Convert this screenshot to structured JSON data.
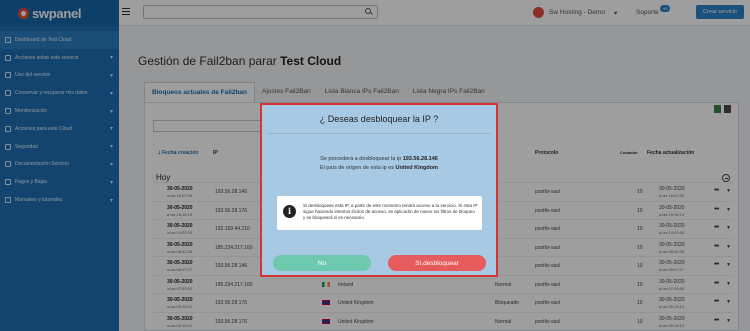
{
  "sidebar": {
    "logo_text": "swpanel",
    "items": [
      {
        "label": "Dashboard de Test Cloud",
        "icon": "dashboard-icon",
        "active": true,
        "caret": ""
      },
      {
        "label": "Acciones sobre este servicio",
        "icon": "gear-icon",
        "caret": "▾"
      },
      {
        "label": "Uso del servicio",
        "icon": "chart-icon",
        "caret": "▾"
      },
      {
        "label": "Conservar y recuperar mis datos",
        "icon": "database-icon",
        "caret": "▾"
      },
      {
        "label": "Monitorización",
        "icon": "monitor-icon",
        "caret": "▾"
      },
      {
        "label": "Acciones para este Cloud",
        "icon": "cloud-icon",
        "caret": "▾"
      },
      {
        "label": "Seguridad",
        "icon": "shield-icon",
        "caret": "▾"
      },
      {
        "label": "Documentación Servicio",
        "icon": "document-icon",
        "caret": "▾"
      },
      {
        "label": "Pagos y Bajas",
        "icon": "payment-icon",
        "caret": "▾"
      },
      {
        "label": "Manuales y tutoriales",
        "icon": "help-icon",
        "caret": "▾"
      }
    ]
  },
  "topbar": {
    "account": "Sw Hosting - Demo",
    "account_caret": "▾",
    "support": "Soporte",
    "support_badge": "99",
    "new_service_button": "Crear servicio"
  },
  "main": {
    "title_prefix": "Gestión de Fail2ban parar",
    "title_bold": "Test Cloud",
    "tabs": [
      {
        "label": "Bloqueos actuales de Fail2ban",
        "active": true
      },
      {
        "label": "Ajustes Fail2Ban"
      },
      {
        "label": "Lista Blanca IPs Fail2Ban"
      },
      {
        "label": "Lista Negra IPs Fail2Ban"
      }
    ],
    "table": {
      "headers": {
        "fecha": "Fecha creación",
        "ip": "IP",
        "protocolo": "Protocolo",
        "contador": "Contador",
        "actualizacion": "Fecha actualización"
      },
      "sort_arrow": "🡓",
      "group_label": "Hoy",
      "rows": [
        {
          "d1": "30-05-2020",
          "d2": "a las 16:07:29",
          "ip": "193.56.28.146",
          "country": "",
          "status": "",
          "protocol": "postfix-sasl",
          "count": "10",
          "u1": "30-05-2020",
          "u2": "a las 16:07:29"
        },
        {
          "d1": "30-05-2020",
          "d2": "a las 15:16:13",
          "ip": "193.56.28.176",
          "country": "",
          "status": "",
          "protocol": "postfix-sasl",
          "count": "10",
          "u1": "30-05-2020",
          "u2": "a las 15:16:13"
        },
        {
          "d1": "30-05-2020",
          "d2": "a las 14:02:03",
          "ip": "192.169.44.210",
          "country": "",
          "status": "",
          "protocol": "postfix-sasl",
          "count": "10",
          "u1": "30-05-2020",
          "u2": "a las 14:02:03"
        },
        {
          "d1": "30-05-2020",
          "d2": "a las 08:42:28",
          "ip": "185.234.217.160",
          "country": "",
          "status": "",
          "protocol": "postfix-sasl",
          "count": "10",
          "u1": "30-05-2020",
          "u2": "a las 08:42:28"
        },
        {
          "d1": "30-05-2020",
          "d2": "a las 08:07:27",
          "ip": "193.56.28.146",
          "country": "",
          "status": "",
          "protocol": "postfix-sasl",
          "count": "10",
          "u1": "30-05-2020",
          "u2": "a las 08:07:27"
        },
        {
          "d1": "30-05-2020",
          "d2": "a las 07:53:52",
          "ip": "185.234.217.160",
          "country": "Ireland",
          "status": "Normal",
          "protocol": "postfix-sasl",
          "count": "10",
          "u1": "30-05-2020",
          "u2": "a las 07:53:52",
          "flag": "ie"
        },
        {
          "d1": "30-05-2020",
          "d2": "a las 05:16:12",
          "ip": "193.56.28.176",
          "country": "United Kingdom",
          "status": "Bloqueado",
          "protocol": "postfix-sasl",
          "count": "10",
          "u1": "30-05-2020",
          "u2": "a las 05:16:12",
          "flag": "uk"
        },
        {
          "d1": "30-05-2020",
          "d2": "a las 05:16:12",
          "ip": "193.56.28.176",
          "country": "United Kingdom",
          "status": "Normal",
          "protocol": "postfix-sasl",
          "count": "10",
          "u1": "30-05-2020",
          "u2": "a las 05:16:12",
          "flag": "uk"
        }
      ]
    }
  },
  "modal": {
    "title": "¿ Deseas desbloquear la IP ?",
    "line1_prefix": "Se procederá a desbloquear la ip",
    "line1_ip": "193.56.28.146",
    "line2_prefix": "El país de origen de esta ip es",
    "line2_country": "United Kingdom",
    "warning": "Si desbloqueas esta IP, a partir de este momento tendrá acceso a tu servicio. Si esta IP sigue haciendo intentos ilícitos de acceso, se aplicarán de nuevo los filtros de bloqueo y se bloqueará si es necesario.",
    "no_button": "No",
    "yes_button": "Sí,desbloquear"
  },
  "colors": {
    "sidebar": "#1d6fb4",
    "accent": "#2b82c9",
    "modal_bg": "#a8c9e4",
    "modal_border": "#d53434",
    "no_button": "#6fc9ae",
    "yes_button": "#e65b5b"
  }
}
